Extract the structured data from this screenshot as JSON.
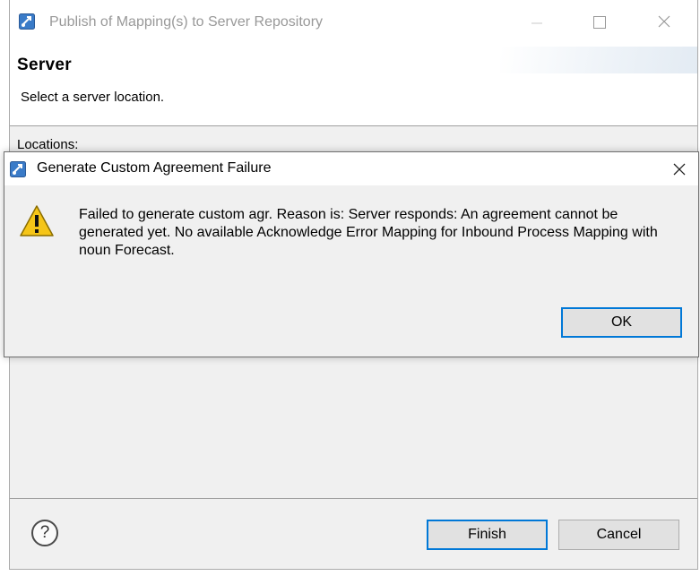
{
  "main_window": {
    "title": "Publish of Mapping(s) to Server Repository",
    "section_title": "Server",
    "section_description": "Select a server location.",
    "locations_label": "Locations:",
    "help_label": "?",
    "finish_label": "Finish",
    "cancel_label": "Cancel"
  },
  "dialog": {
    "title": "Generate Custom Agreement Failure",
    "message": "Failed to generate custom agr. Reason is: Server responds: An agreement cannot be generated yet. No available Acknowledge Error Mapping for Inbound Process Mapping with noun Forecast.",
    "ok_label": "OK"
  },
  "icons": {
    "app": "app-icon",
    "warning": "warning-icon",
    "close": "close-icon",
    "minimize": "minimize-icon",
    "maximize": "maximize-icon",
    "help": "help-icon"
  },
  "colors": {
    "accent": "#0078d7",
    "window_bg": "#f0f0f0",
    "warning_fill": "#f5c518"
  }
}
